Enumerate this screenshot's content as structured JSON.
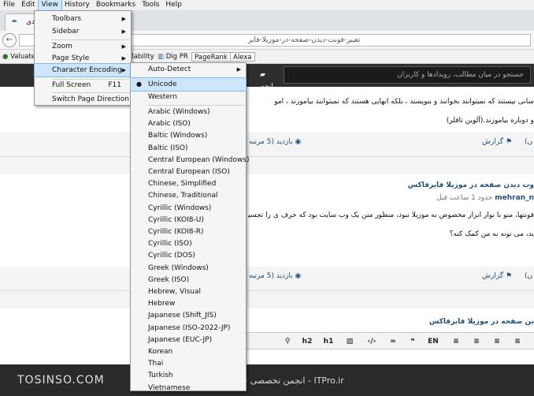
{
  "menubar": [
    "File",
    "Edit",
    "View",
    "History",
    "Bookmarks",
    "Tools",
    "Help"
  ],
  "tab": {
    "label": "دی",
    "favicon": "feather-icon"
  },
  "url": "تغییر-فونت-دیدن-صفحه-در-موزیلا-فایر",
  "bookmarks": [
    "Valuate",
    "ilability",
    "Dig PR",
    "PageRank",
    "Alexa"
  ],
  "site_header": {
    "search_placeholder": "جستجو در میان مطالب، رویدادها و کاربران",
    "button": "انجم"
  },
  "posts": [
    {
      "line1": "سانی نیستند که نمیتوانند بخوانند و بنویسند ، بلکه آنهایی هستند که نمیتوانند بیاموزند ، آمو",
      "line2": "و دوباره بیاموزند.(آلوین تافلر)",
      "views": "بازدید (5 مرتبه",
      "report": "گزارش",
      "left": "(ں"
    },
    {
      "title": "وت دیدن صفحه در موزیلا فایرفاکس",
      "author": "mehran_n",
      "time": "حدود 1 ساعت قبل",
      "line1": "فونتها، منو با نوار ابزار مخصوص به موزیلا نبود، منظور متن یک وب سایت بود که حرف ی را تجسیم",
      "line2": "ید، می تونه به من کمک کنه؟",
      "views": "بازدید (5 مرتبه",
      "report": "گزارش",
      "left": "(ں"
    },
    {
      "title": "بن صفحه در موزیلا فایرفاکس"
    }
  ],
  "editor_tools": [
    "h2",
    "h1",
    "EN"
  ],
  "footer": {
    "brand": "TOSINSO.COM",
    "tagline": "ITPro.ir - انجمن تخصصی فناوری اطلاعات ایران"
  },
  "view_menu": {
    "items": [
      {
        "label": "Toolbars",
        "submenu": true
      },
      {
        "label": "Sidebar",
        "submenu": true
      },
      {
        "label": "Zoom",
        "submenu": true
      },
      {
        "label": "Page Style",
        "submenu": true
      },
      {
        "label": "Character Encoding",
        "submenu": true
      },
      {
        "label": "Full Screen",
        "shortcut": "F11"
      },
      {
        "label": "Switch Page Direction"
      }
    ]
  },
  "encoding_menu": {
    "auto_detect": "Auto-Detect",
    "checked": "Unicode",
    "western": "Western",
    "list": [
      "Arabic (Windows)",
      "Arabic (ISO)",
      "Baltic (Windows)",
      "Baltic (ISO)",
      "Central European (Windows)",
      "Central European (ISO)",
      "Chinese, Simplified",
      "Chinese, Traditional",
      "Cyrillic (Windows)",
      "Cyrillic (KOI8-U)",
      "Cyrillic (KOI8-R)",
      "Cyrillic (ISO)",
      "Cyrillic (DOS)",
      "Greek (Windows)",
      "Greek (ISO)",
      "Hebrew, Visual",
      "Hebrew",
      "Japanese (Shift_JIS)",
      "Japanese (ISO-2022-JP)",
      "Japanese (EUC-JP)",
      "Korean",
      "Thai",
      "Turkish",
      "Vietnamese"
    ]
  }
}
